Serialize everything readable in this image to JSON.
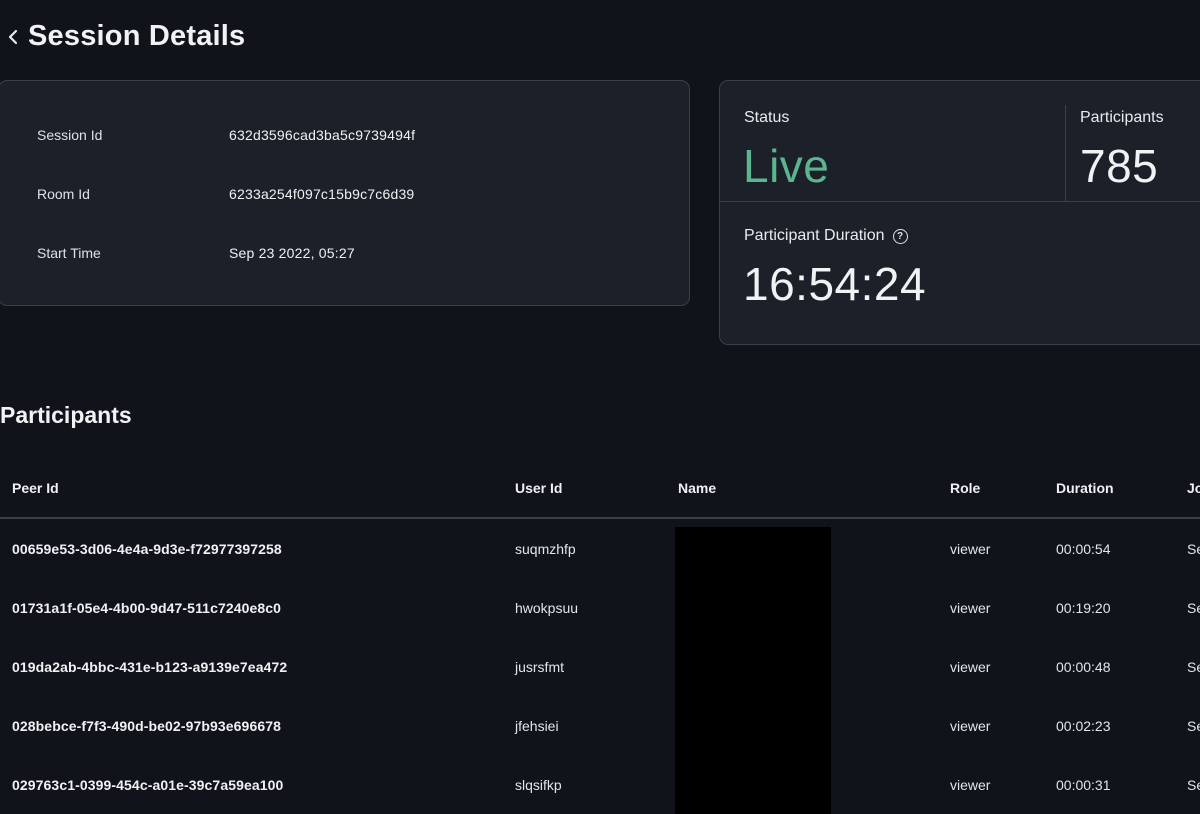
{
  "header": {
    "title": "Session Details"
  },
  "session": {
    "rows": [
      {
        "label": "Session Id",
        "value": "632d3596cad3ba5c9739494f"
      },
      {
        "label": "Room Id",
        "value": "6233a254f097c15b9c7c6d39"
      },
      {
        "label": "Start Time",
        "value": "Sep 23 2022, 05:27"
      }
    ]
  },
  "stats": {
    "status_label": "Status",
    "status_value": "Live",
    "participants_label": "Participants",
    "participants_value": "785",
    "duration_label": "Participant Duration",
    "duration_value": "16:54:24"
  },
  "participants": {
    "title": "Participants",
    "columns": [
      "Peer Id",
      "User Id",
      "Name",
      "Role",
      "Duration",
      "Jo"
    ],
    "rows": [
      {
        "peer_id": "00659e53-3d06-4e4a-9d3e-f72977397258",
        "user_id": "suqmzhfp",
        "role": "viewer",
        "duration": "00:00:54",
        "joined": "Se"
      },
      {
        "peer_id": "01731a1f-05e4-4b00-9d47-511c7240e8c0",
        "user_id": "hwokpsuu",
        "role": "viewer",
        "duration": "00:19:20",
        "joined": "Se"
      },
      {
        "peer_id": "019da2ab-4bbc-431e-b123-a9139e7ea472",
        "user_id": "jusrsfmt",
        "role": "viewer",
        "duration": "00:00:48",
        "joined": "Se"
      },
      {
        "peer_id": "028bebce-f7f3-490d-be02-97b93e696678",
        "user_id": "jfehsiei",
        "role": "viewer",
        "duration": "00:02:23",
        "joined": "Se"
      },
      {
        "peer_id": "029763c1-0399-454c-a01e-39c7a59ea100",
        "user_id": "slqsifkp",
        "role": "viewer",
        "duration": "00:00:31",
        "joined": "Se"
      }
    ]
  },
  "colors": {
    "background": "#10131a",
    "card": "#1c2028",
    "border": "#3a3f49",
    "live": "#5bb68f"
  },
  "icons": {
    "back": "chevron-left-icon",
    "help": "question-circle-icon"
  }
}
